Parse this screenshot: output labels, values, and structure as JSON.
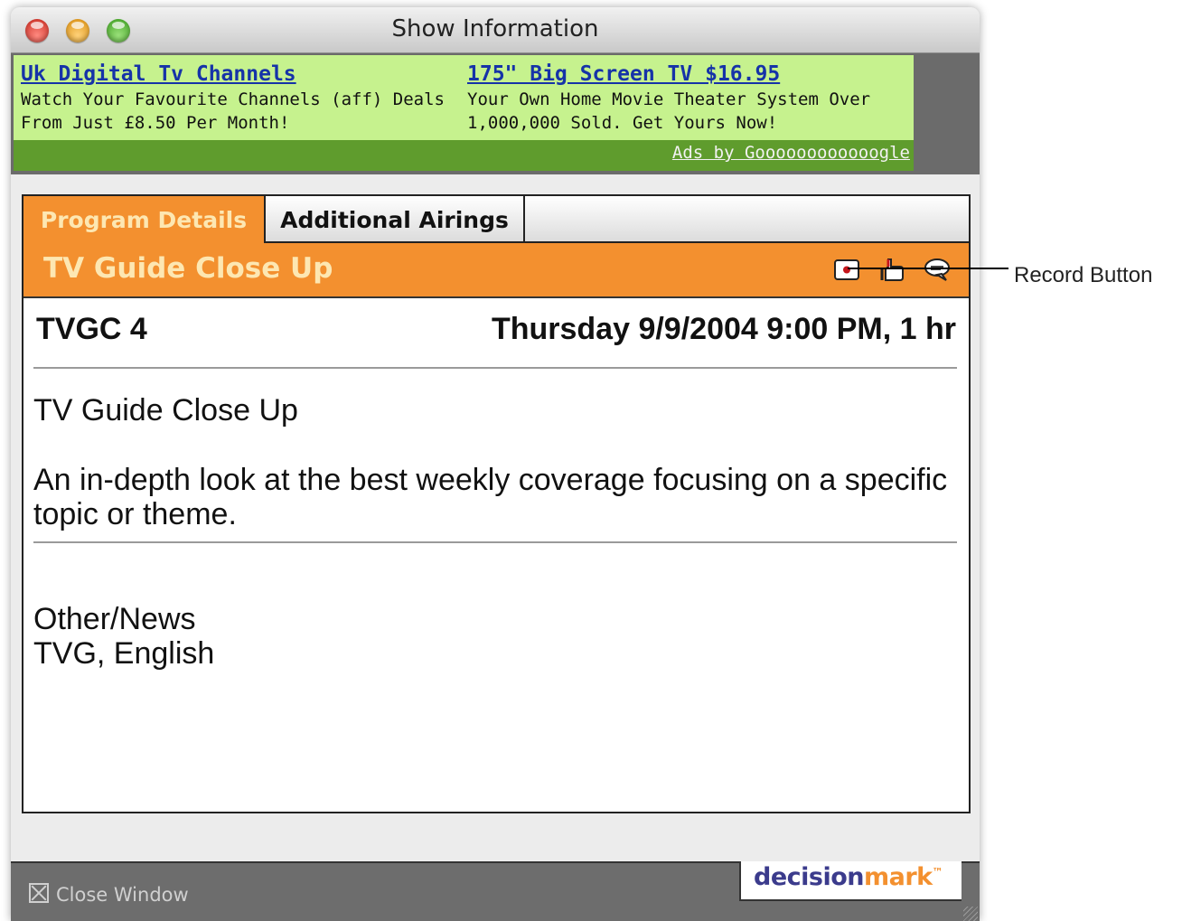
{
  "window": {
    "title": "Show Information"
  },
  "ads": [
    {
      "title": "Uk Digital Tv Channels",
      "body": "Watch Your Favourite Channels (aff) Deals From Just £8.50 Per Month!"
    },
    {
      "title": "175\" Big Screen TV $16.95",
      "body": "Your Own Home Movie Theater System Over 1,000,000 Sold. Get Yours Now!"
    }
  ],
  "ads_by": "Ads by Goooooooooooogle",
  "tabs": [
    {
      "label": "Program Details",
      "active": true
    },
    {
      "label": "Additional Airings",
      "active": false
    }
  ],
  "show": {
    "title": "TV Guide Close Up",
    "channel": "TVGC 4",
    "airtime": "Thursday 9/9/2004 9:00 PM, 1 hr",
    "program_name": "TV Guide Close Up",
    "description": "An in-depth look at the best weekly coverage focusing on a specific topic or theme.",
    "genre": "Other/News",
    "rating": "TVG, English"
  },
  "toolbar_icons": [
    "record-icon",
    "thumb-icon",
    "chat-icon"
  ],
  "footer": {
    "close_label": "Close Window",
    "logo_part1": "decision",
    "logo_part2": "mark",
    "logo_tm": "™"
  },
  "callout": {
    "label": "Record Button"
  },
  "colors": {
    "accent_orange": "#f3902f",
    "ad_green": "#c6f28e",
    "ad_strip": "#5f9c2d",
    "link_blue": "#1633a8",
    "logo_blue": "#3b3b8c"
  }
}
